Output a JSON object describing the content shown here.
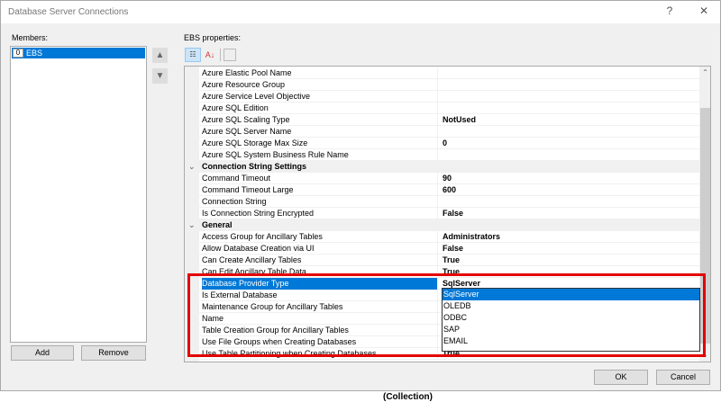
{
  "window": {
    "title": "Database Server Connections",
    "help_label": "?",
    "close_label": "✕"
  },
  "members": {
    "label": "Members:",
    "items": [
      {
        "index": "0",
        "name": "EBS"
      }
    ],
    "add_label": "Add",
    "remove_label": "Remove",
    "up_icon": "▲",
    "down_icon": "▼"
  },
  "properties": {
    "label": "EBS properties:",
    "toolbar": {
      "categorized_icon": "categorized-icon",
      "alphabetical_label": "A↓",
      "pages_icon": "property-pages-icon"
    },
    "rows": [
      {
        "name": "Azure Elastic Pool Name",
        "value": ""
      },
      {
        "name": "Azure Resource Group",
        "value": ""
      },
      {
        "name": "Azure Service Level Objective",
        "value": ""
      },
      {
        "name": "Azure SQL Edition",
        "value": ""
      },
      {
        "name": "Azure SQL Scaling Type",
        "value": "NotUsed"
      },
      {
        "name": "Azure SQL Server Name",
        "value": ""
      },
      {
        "name": "Azure SQL Storage Max Size",
        "value": "0"
      },
      {
        "name": "Azure SQL System Business Rule Name",
        "value": ""
      }
    ],
    "category1": {
      "title": "Connection String Settings",
      "chevron": "⌄"
    },
    "rows_conn": [
      {
        "name": "Command Timeout",
        "value": "90"
      },
      {
        "name": "Command Timeout Large",
        "value": "600"
      },
      {
        "name": "Connection String",
        "value": ""
      },
      {
        "name": "Is Connection String Encrypted",
        "value": "False"
      }
    ],
    "category2": {
      "title": "General",
      "chevron": "⌄"
    },
    "rows_general": [
      {
        "name": "Access Group for Ancillary Tables",
        "value": "Administrators"
      },
      {
        "name": "Allow Database Creation via UI",
        "value": "False"
      },
      {
        "name": "Can Create Ancillary Tables",
        "value": "True"
      },
      {
        "name": "Can Edit Ancillary Table Data",
        "value": "True"
      },
      {
        "name": "Database Provider Type",
        "value": "SqlServer"
      },
      {
        "name": "Is External Database",
        "value": ""
      },
      {
        "name": "Maintenance Group for Ancillary Tables",
        "value": ""
      },
      {
        "name": "Name",
        "value": ""
      },
      {
        "name": "Table Creation Group for Ancillary Tables",
        "value": ""
      },
      {
        "name": "Use File Groups when Creating Databases",
        "value": ""
      },
      {
        "name": "Use Table Partitioning when Creating Databases",
        "value": "True"
      }
    ],
    "dropdown": {
      "options": [
        "SqlServer",
        "OLEDB",
        "ODBC",
        "SAP",
        "EMAIL"
      ],
      "selected": "SqlServer"
    }
  },
  "footer": {
    "ok_label": "OK",
    "cancel_label": "Cancel"
  },
  "background": {
    "collection_text": "(Collection)"
  },
  "colors": {
    "selection": "#0078d7",
    "highlight_box": "#e30000"
  }
}
